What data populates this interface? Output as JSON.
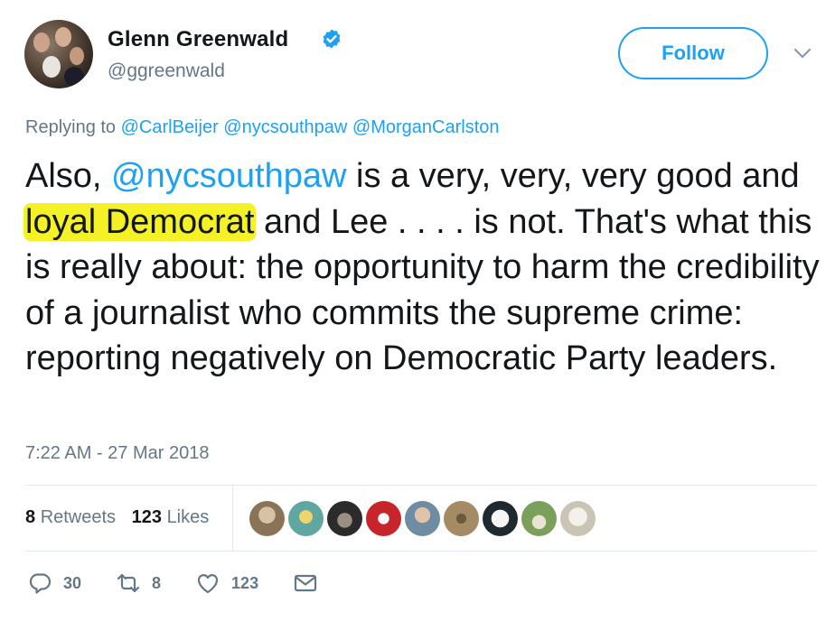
{
  "author": {
    "name": "Glenn Greenwald",
    "handle": "@ggreenwald",
    "verified": true
  },
  "follow_button": {
    "label": "Follow"
  },
  "reply_context": {
    "prefix": "Replying to",
    "mentions": [
      "@CarlBeijer",
      "@nycsouthpaw",
      "@MorganCarlston"
    ]
  },
  "tweet": {
    "part1": "Also, ",
    "mention": "@nycsouthpaw",
    "part2": " is a very, very, very good and ",
    "highlight": "loyal Democrat",
    "part3": " and Lee . . . . is not. That's what this is really about: the opportunity to harm the credibility of a journalist who commits the supreme crime: reporting negatively on Democratic Party leaders.",
    "highlight_color": "#f4f226"
  },
  "timestamp": "7:22 AM - 27 Mar 2018",
  "stats": {
    "retweets_count": "8",
    "retweets_label": "Retweets",
    "likes_count": "123",
    "likes_label": "Likes"
  },
  "likers": [
    {
      "name": "liker-1",
      "color": "#8b7358"
    },
    {
      "name": "liker-2",
      "color": "#5fa7a0"
    },
    {
      "name": "liker-3",
      "color": "#2b2b2b"
    },
    {
      "name": "liker-4",
      "color": "#c8252b"
    },
    {
      "name": "liker-5",
      "color": "#6f8ca2"
    },
    {
      "name": "liker-6",
      "color": "#a58b63"
    },
    {
      "name": "liker-7",
      "color": "#1f2a30"
    },
    {
      "name": "liker-8",
      "color": "#7aa05a"
    },
    {
      "name": "liker-9",
      "color": "#c9c4b6"
    }
  ],
  "actions": {
    "reply_count": "30",
    "retweet_count": "8",
    "like_count": "123"
  },
  "icons": {
    "reply": "reply-icon",
    "retweet": "retweet-icon",
    "like": "heart-icon",
    "dm": "envelope-icon",
    "verified": "verified-badge-icon",
    "menu": "chevron-down-icon"
  },
  "colors": {
    "accent": "#1da1f2",
    "secondary_text": "#657786",
    "primary_text": "#14171a"
  }
}
